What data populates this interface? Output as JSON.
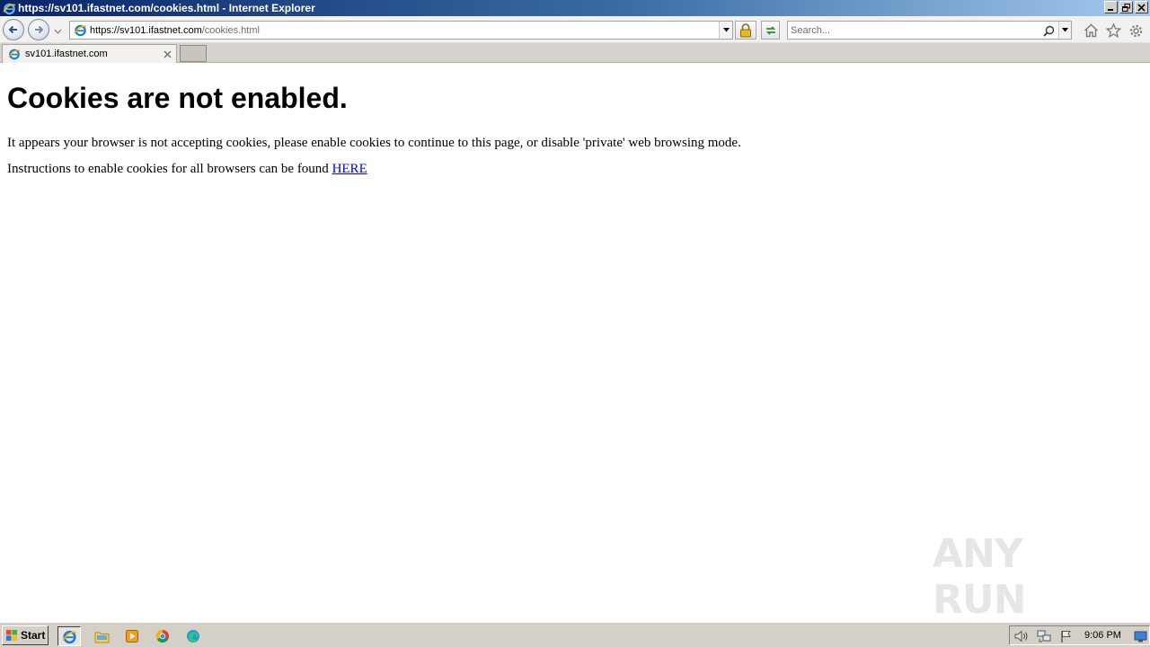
{
  "window": {
    "title": "https://sv101.ifastnet.com/cookies.html - Internet Explorer"
  },
  "navbar": {
    "address_host": "https://sv101.ifastnet.com",
    "address_path": "/cookies.html",
    "search_placeholder": "Search..."
  },
  "tabs": [
    {
      "label": "sv101.ifastnet.com",
      "active": true
    }
  ],
  "page": {
    "heading": "Cookies are not enabled.",
    "paragraph1": "It appears your browser is not accepting cookies, please enable cookies to continue to this page, or disable 'private' web browsing mode.",
    "paragraph2_text": "Instructions to enable cookies for all browsers can be found ",
    "paragraph2_link": "HERE"
  },
  "watermark": {
    "text": "ANY RUN"
  },
  "taskbar": {
    "start_label": "Start",
    "pinned_icons": [
      "internet-explorer-icon",
      "folder-icon",
      "media-player-icon",
      "chrome-icon",
      "edge-icon"
    ],
    "tray_icons": [
      "speaker-icon",
      "network-icon",
      "flag-icon"
    ],
    "clock": "9:06 PM"
  },
  "colors": {
    "titlebar_start": "#0a246a",
    "titlebar_end": "#a6caf0",
    "link": "#0000ee",
    "taskbar": "#d4d0c8"
  }
}
